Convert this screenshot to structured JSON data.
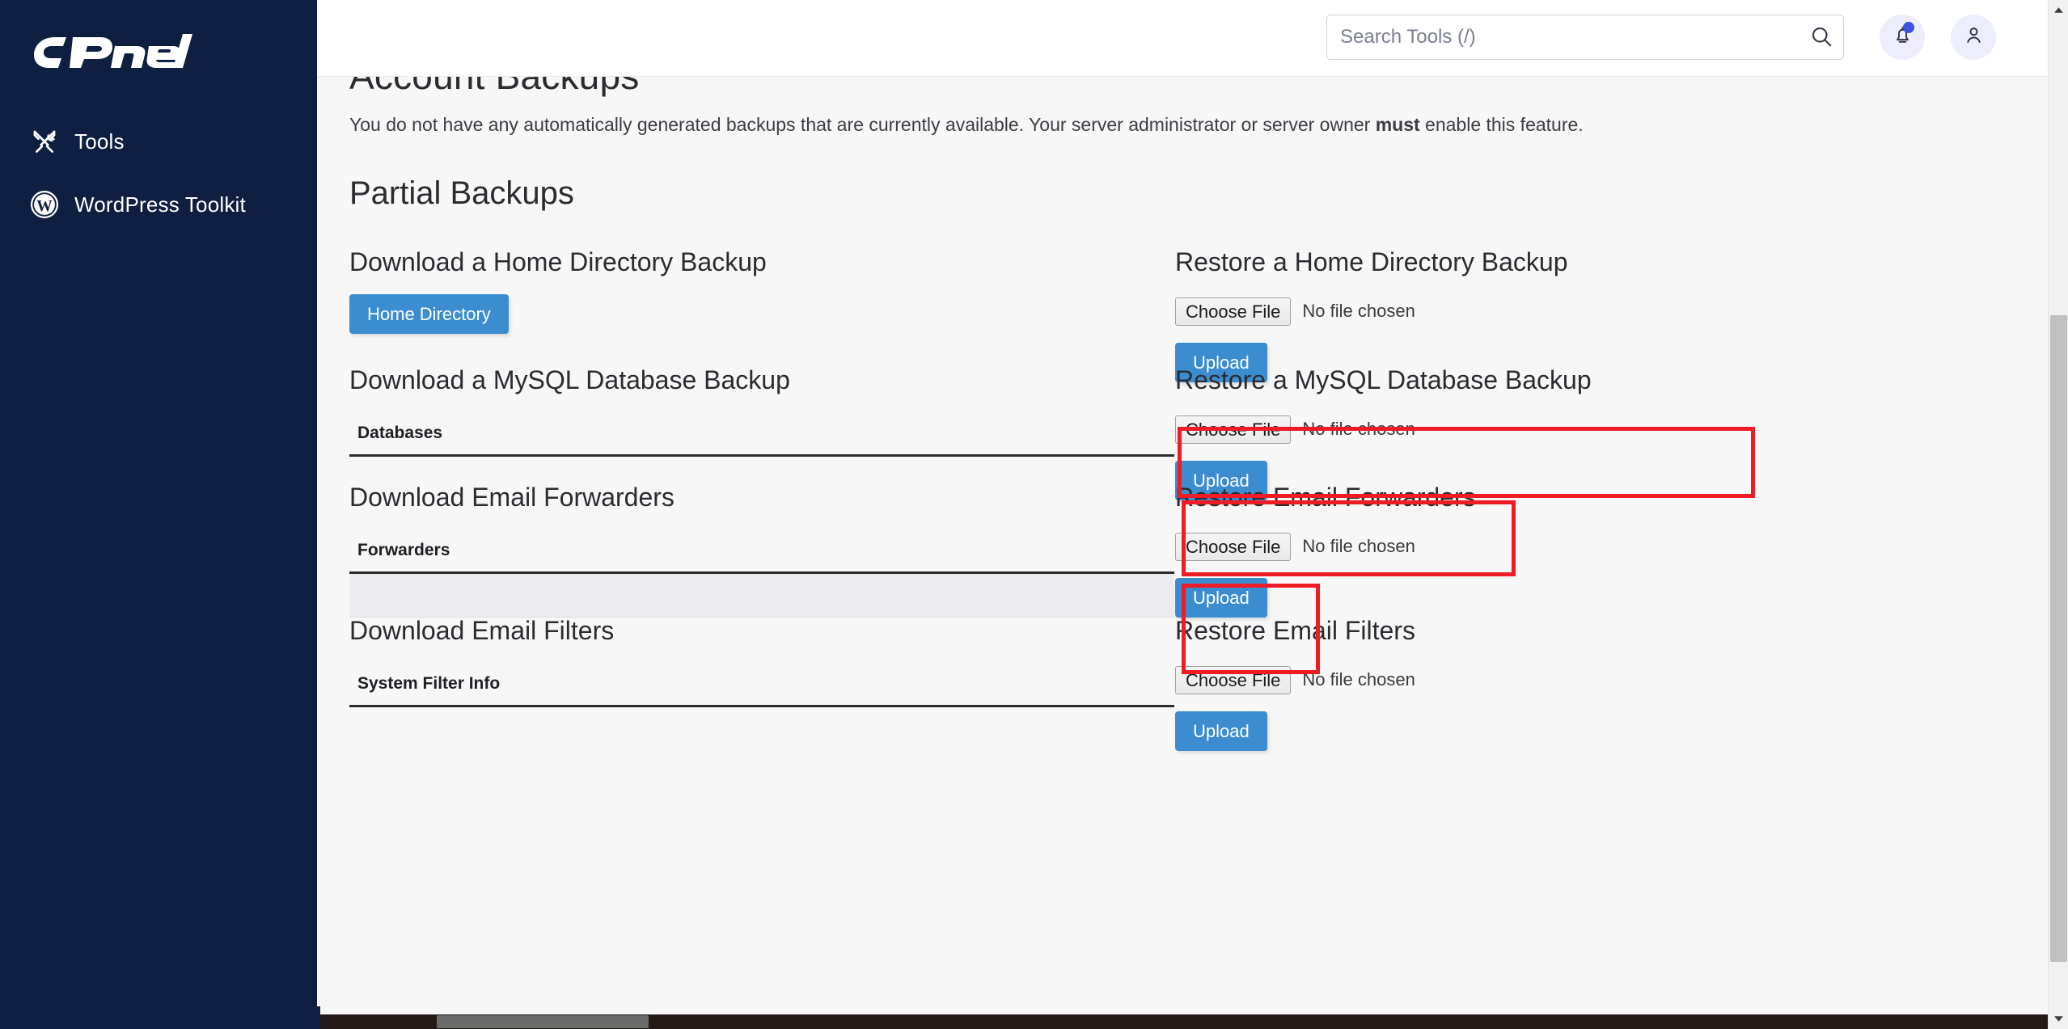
{
  "sidebar": {
    "brand": "cPanel",
    "items": [
      {
        "label": "Tools",
        "icon": "tools-icon"
      },
      {
        "label": "WordPress Toolkit",
        "icon": "wordpress-icon"
      }
    ]
  },
  "header": {
    "search_placeholder": "Search Tools (/)",
    "search_value": "",
    "search_icon": "search-icon",
    "notifications_icon": "bell-icon",
    "notifications_has_badge": true,
    "account_icon": "user-icon"
  },
  "main": {
    "page_title": "Account Backups",
    "page_description_prefix": "You do not have any automatically generated backups that are currently available. Your server administrator or server owner ",
    "page_description_bold": "must",
    "page_description_suffix": " enable this feature.",
    "section_title": "Partial Backups",
    "blocks": [
      {
        "download_heading": "Download a Home Directory Backup",
        "download_button": "Home Directory",
        "restore_heading": "Restore a Home Directory Backup",
        "choose_file_label": "Choose File",
        "no_file_label": "No file chosen",
        "upload_label": "Upload"
      },
      {
        "download_heading": "Download a MySQL Database Backup",
        "table_header": "Databases",
        "restore_heading": "Restore a MySQL Database Backup",
        "choose_file_label": "Choose File",
        "no_file_label": "No file chosen",
        "upload_label": "Upload"
      },
      {
        "download_heading": "Download Email Forwarders",
        "table_header": "Forwarders",
        "restore_heading": "Restore Email Forwarders",
        "choose_file_label": "Choose File",
        "no_file_label": "No file chosen",
        "upload_label": "Upload"
      },
      {
        "download_heading": "Download Email Filters",
        "table_header": "System Filter Info",
        "restore_heading": "Restore Email Filters",
        "choose_file_label": "Choose File",
        "no_file_label": "No file chosen",
        "upload_label": "Upload"
      }
    ]
  },
  "annotations": {
    "color": "#ee1c25",
    "boxes": [
      {
        "target": "restore-mysql-heading"
      },
      {
        "target": "restore-mysql-file-input"
      },
      {
        "target": "restore-mysql-upload-button"
      }
    ]
  },
  "colors": {
    "sidebar_bg": "#0e1f41",
    "content_bg": "#f7f7f8",
    "primary_button": "#3b8dd0",
    "annotation_red": "#ee1c25",
    "badge_blue": "#3b55e0"
  },
  "scrollbars": {
    "vertical_thumb_top_pct": 31,
    "horizontal_thumb_left_pct": 7
  }
}
